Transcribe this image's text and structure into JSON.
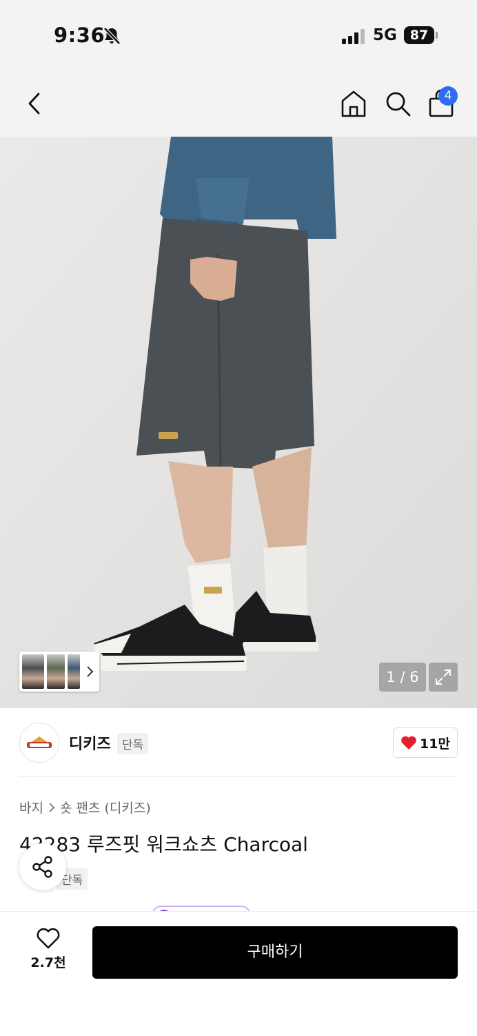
{
  "status_bar": {
    "time": "9:36",
    "network": "5G",
    "battery": "87"
  },
  "nav": {
    "cart_count": "4",
    "icons": [
      "back-icon",
      "home-icon",
      "search-icon",
      "shopping-bag-icon"
    ]
  },
  "gallery": {
    "counter": "1 / 6",
    "thumbnail_count": 3,
    "icons": [
      "chevron-right-icon",
      "expand-icon"
    ]
  },
  "brand": {
    "name": "디키즈",
    "tag": "단독",
    "likes": "11만"
  },
  "breadcrumb": {
    "category": "바지",
    "subcategory": "숏 팬츠 (디키즈)"
  },
  "product": {
    "title": "42283 루즈핏 워크쇼츠 Charcoal",
    "tag": "단독"
  },
  "bottom": {
    "wish_count": "2.7천",
    "buy_label": "구매하기"
  },
  "colors": {
    "cart_badge": "#2f6df0",
    "heart": "#e5202c",
    "buy_button": "#000000"
  }
}
